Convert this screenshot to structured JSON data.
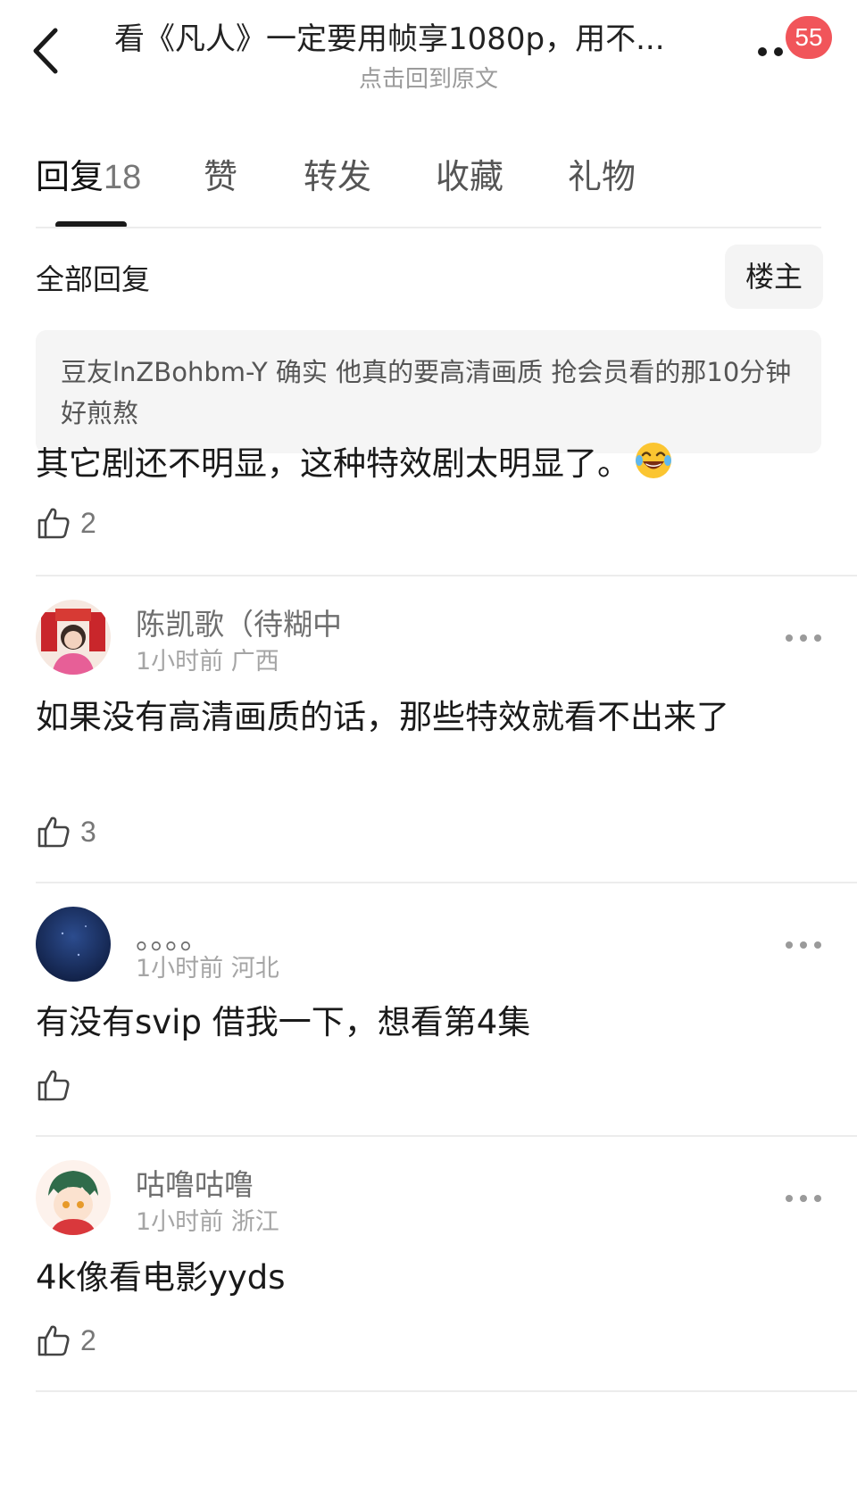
{
  "header": {
    "title": "看《凡人》一定要用帧享1080p，用不...",
    "subtitle": "点击回到原文",
    "badge_count": "55"
  },
  "tabs": [
    {
      "label": "回复",
      "count": "18",
      "active": true
    },
    {
      "label": "赞"
    },
    {
      "label": "转发"
    },
    {
      "label": "收藏"
    },
    {
      "label": "礼物"
    }
  ],
  "filter": {
    "all_replies_label": "全部回复",
    "op_button_label": "楼主"
  },
  "quote": {
    "text": "豆友lnZBohbm-Y 确实 他真的要高清画质 抢会员看的那10分钟好煎熬"
  },
  "op_reply": {
    "text": "其它剧还不明显，这种特效剧太明显了。",
    "emoji_icon": "laughing-tears-emoji",
    "likes": "2"
  },
  "comments": [
    {
      "username": "陈凯歌（待糊中",
      "time": "1小时前",
      "location": "广西",
      "text": "如果没有高清画质的话，那些特效就看不出来了",
      "likes": "3"
    },
    {
      "username": "。。。。",
      "time": "1小时前",
      "location": "河北",
      "text": "有没有svip 借我一下，想看第4集",
      "likes": ""
    },
    {
      "username": "咕噜咕噜",
      "time": "1小时前",
      "location": "浙江",
      "text": "4k像看电影yyds",
      "likes": "2"
    }
  ],
  "colors": {
    "badge": "#f1555a",
    "quote_bg": "#f5f5f5",
    "divider": "#ececec"
  }
}
